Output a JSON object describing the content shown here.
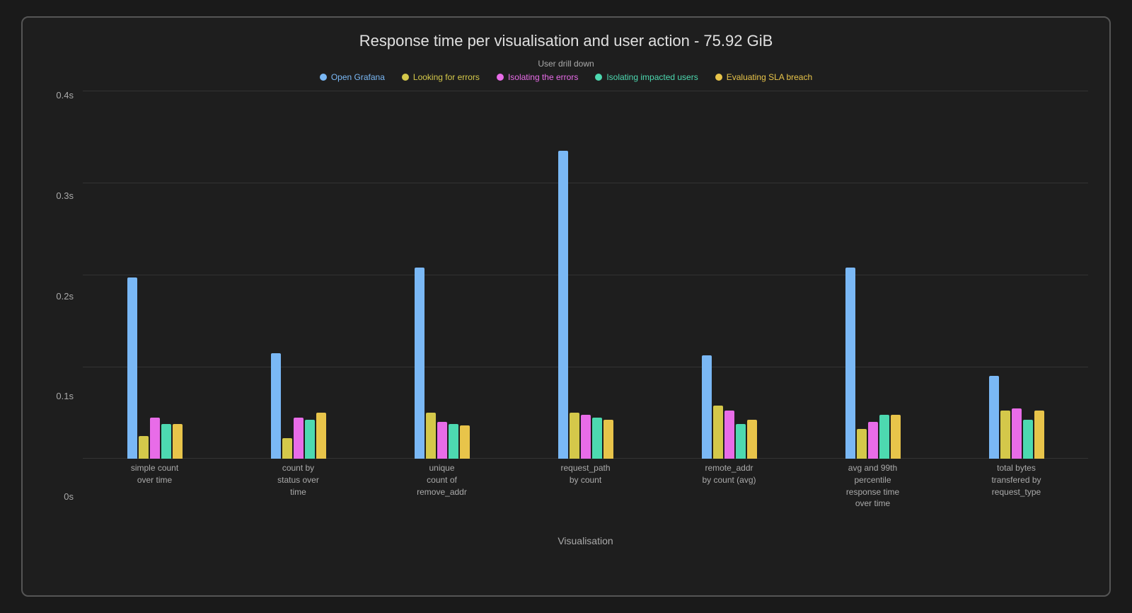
{
  "chart": {
    "title": "Response time per visualisation and user action - 75.92 GiB",
    "legend": {
      "group_label": "User drill down",
      "items": [
        {
          "label": "Open Grafana",
          "color": "#7ab8f5"
        },
        {
          "label": "Looking for errors",
          "color": "#d4c84a"
        },
        {
          "label": "Isolating the errors",
          "color": "#e86ce8"
        },
        {
          "label": "Isolating impacted users",
          "color": "#4dd9b0"
        },
        {
          "label": "Evaluating SLA breach",
          "color": "#e8c44a"
        }
      ]
    },
    "y_axis": {
      "labels": [
        "0.4s",
        "0.3s",
        "0.2s",
        "0.1s",
        "0s"
      ],
      "max": 0.4
    },
    "x_axis_title": "Visualisation",
    "bar_groups": [
      {
        "label": "simple count\nover time",
        "bars": [
          0.197,
          0.025,
          0.045,
          0.038,
          0.038
        ]
      },
      {
        "label": "count by\nstatus over\ntime",
        "bars": [
          0.115,
          0.022,
          0.045,
          0.042,
          0.05
        ]
      },
      {
        "label": "unique\ncount of\nremove_addr",
        "bars": [
          0.208,
          0.05,
          0.04,
          0.038,
          0.036
        ]
      },
      {
        "label": "request_path\nby count",
        "bars": [
          0.335,
          0.05,
          0.048,
          0.045,
          0.042
        ]
      },
      {
        "label": "remote_addr\nby count (avg)",
        "bars": [
          0.112,
          0.058,
          0.052,
          0.038,
          0.042
        ]
      },
      {
        "label": "avg and 99th\npercentile\nresponse time\nover time",
        "bars": [
          0.208,
          0.032,
          0.04,
          0.048,
          0.048
        ]
      },
      {
        "label": "total bytes\ntransfered by\nrequest_type",
        "bars": [
          0.09,
          0.052,
          0.055,
          0.042,
          0.052
        ]
      }
    ]
  }
}
